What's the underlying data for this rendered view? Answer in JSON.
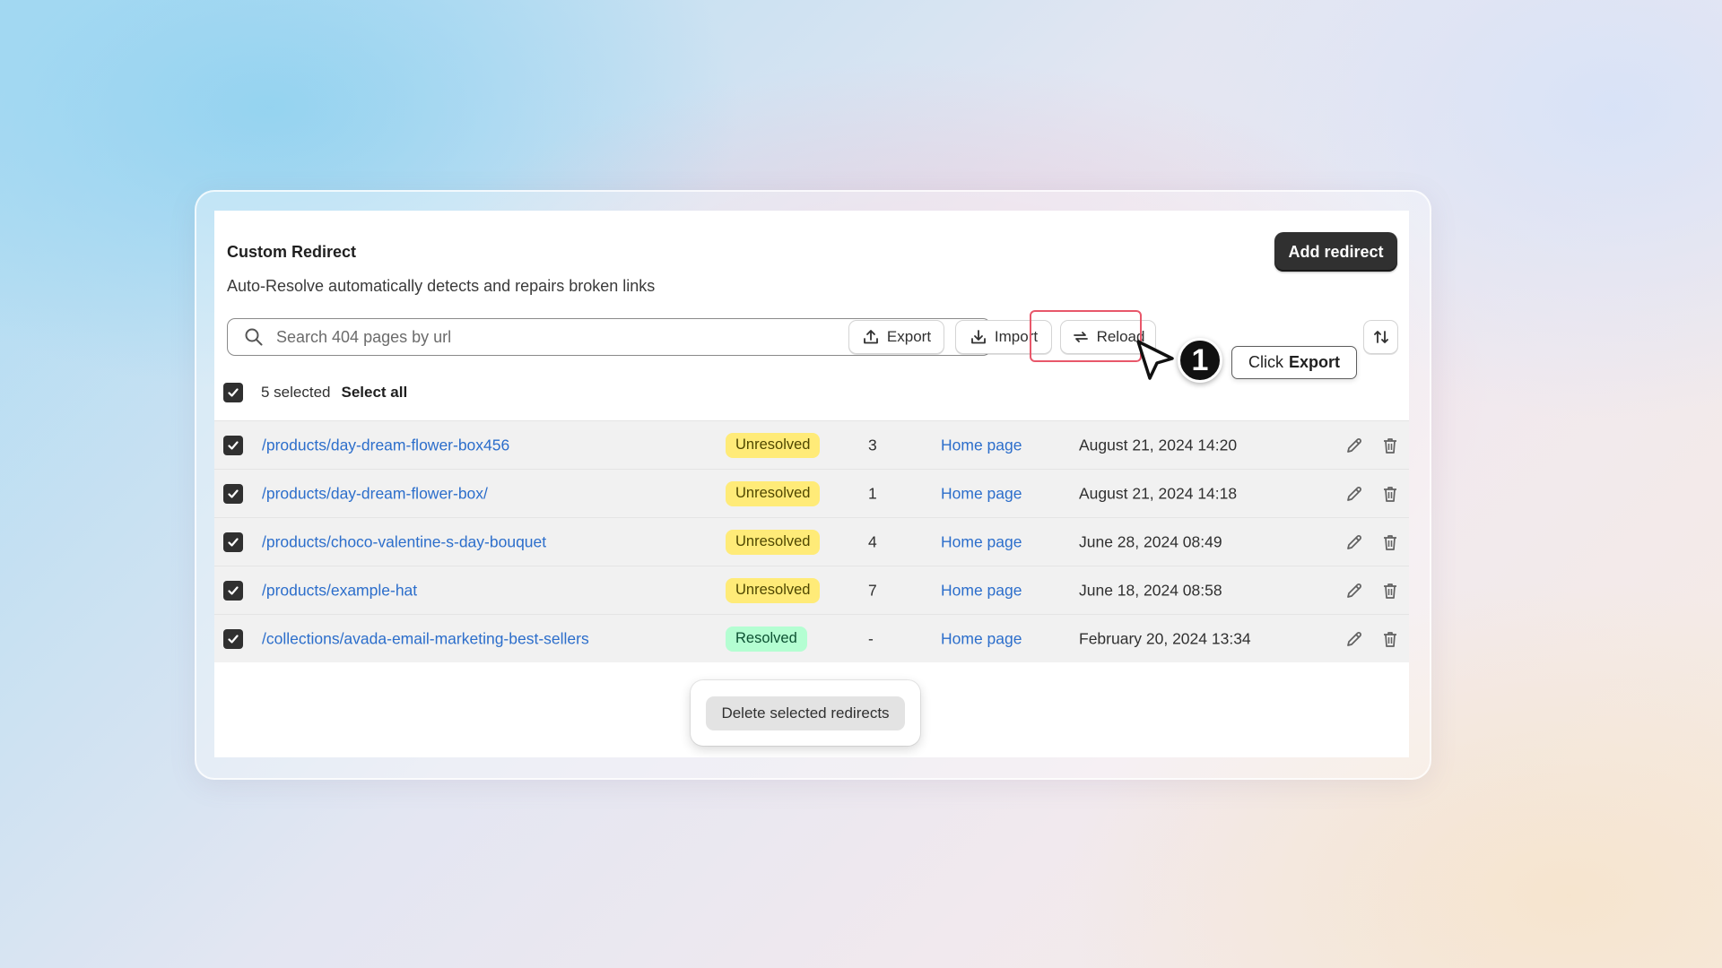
{
  "header": {
    "title": "Custom Redirect",
    "subtitle": "Auto-Resolve automatically detects and repairs broken links",
    "add_button": "Add redirect"
  },
  "search": {
    "placeholder": "Search 404 pages by url",
    "value": ""
  },
  "toolbar": {
    "export": "Export",
    "import": "Import",
    "reload": "Reload",
    "sort_icon": "sort-arrows-icon"
  },
  "selection": {
    "count_label": "5 selected",
    "select_all": "Select all"
  },
  "rows": [
    {
      "url": "/products/day-dream-flower-box456",
      "status": "Unresolved",
      "count": "3",
      "target": "Home page",
      "date": "August 21, 2024 14:20"
    },
    {
      "url": "/products/day-dream-flower-box/",
      "status": "Unresolved",
      "count": "1",
      "target": "Home page",
      "date": "August 21, 2024 14:18"
    },
    {
      "url": "/products/choco-valentine-s-day-bouquet",
      "status": "Unresolved",
      "count": "4",
      "target": "Home page",
      "date": "June 28, 2024 08:49"
    },
    {
      "url": "/products/example-hat",
      "status": "Unresolved",
      "count": "7",
      "target": "Home page",
      "date": "June 18, 2024 08:58"
    },
    {
      "url": "/collections/avada-email-marketing-best-sellers",
      "status": "Resolved",
      "count": "-",
      "target": "Home page",
      "date": "February 20, 2024 13:34"
    }
  ],
  "bulk_action": {
    "delete_label": "Delete selected redirects"
  },
  "guide": {
    "step_number": "1",
    "tooltip_prefix": "Click",
    "tooltip_target": "Export"
  },
  "colors": {
    "link": "#2c6ecb",
    "unresolved_badge": "#ffeb78",
    "resolved_badge": "#b4fed2",
    "highlight": "#e8576a",
    "primary_button": "#303030"
  }
}
